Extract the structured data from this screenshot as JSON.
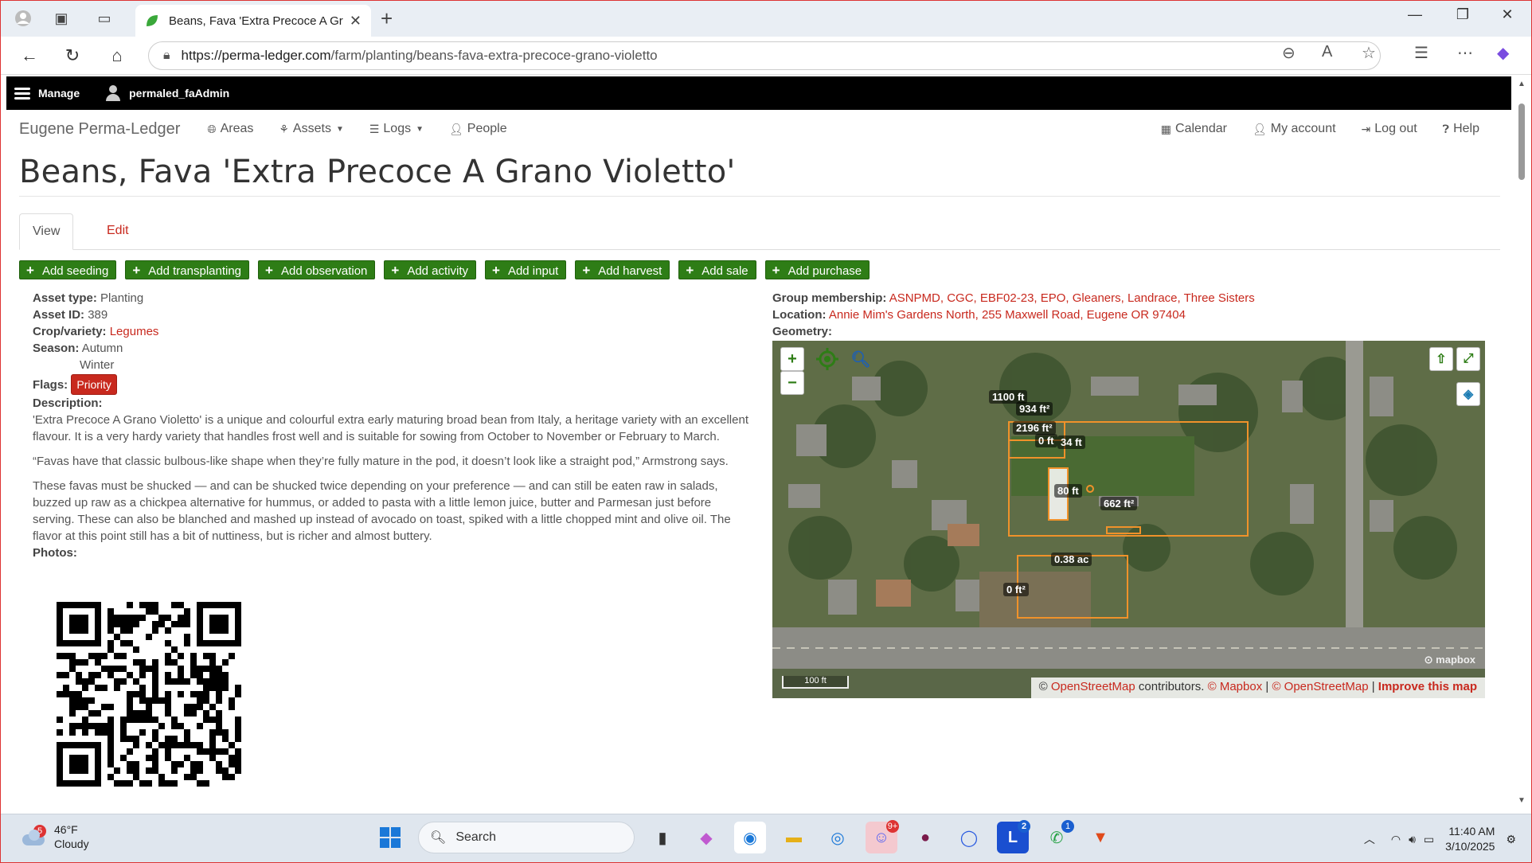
{
  "browser": {
    "tab_title": "Beans, Fava 'Extra Precoce A Gran",
    "url_host": "https://perma-ledger.com",
    "url_path": "/farm/planting/beans-fava-extra-precoce-grano-violetto"
  },
  "adminbar": {
    "manage_label": "Manage",
    "user_label": "permaled_faAdmin"
  },
  "sitenav": {
    "brand": "Eugene Perma-Ledger",
    "areas": "Areas",
    "assets": "Assets",
    "logs": "Logs",
    "people": "People",
    "calendar": "Calendar",
    "account": "My account",
    "logout": "Log out",
    "help": "Help"
  },
  "page": {
    "title": "Beans, Fava 'Extra Precoce A Grano Violetto'",
    "tab_view": "View",
    "tab_edit": "Edit"
  },
  "actions": [
    "Add seeding",
    "Add transplanting",
    "Add observation",
    "Add activity",
    "Add input",
    "Add harvest",
    "Add sale",
    "Add purchase"
  ],
  "details": {
    "asset_type_label": "Asset type:",
    "asset_type": "Planting",
    "asset_id_label": "Asset ID:",
    "asset_id": "389",
    "crop_label": "Crop/variety:",
    "crop": "Legumes",
    "season_label": "Season:",
    "season_1": "Autumn",
    "season_2": "Winter",
    "flags_label": "Flags:",
    "flag": "Priority",
    "description_label": "Description:",
    "desc_p1": "'Extra Precoce A Grano Violetto' is a unique and colourful extra early maturing broad bean from Italy, a heritage variety with an excellent flavour. It is a very hardy variety that handles frost well and is suitable for sowing from October to November or February to March.",
    "desc_p2": "“Favas have that classic bulbous-like shape when they’re fully mature in the pod, it doesn’t look like a straight pod,” Armstrong says.",
    "desc_p3": "These favas must be shucked — and can be shucked twice depending on your preference — and can still be eaten raw in salads, buzzed up raw as a chickpea alternative for hummus, or added to pasta with a little lemon juice, butter and Parmesan just before serving. These can also be blanched and mashed up instead of avocado on toast, spiked with a little chopped mint and olive oil. The flavor at this point still has a bit of nuttiness, but is richer and almost buttery.",
    "photos_label": "Photos:"
  },
  "right": {
    "group_label": "Group membership:",
    "groups": "ASNPMD, CGC, EBF02-23, EPO, Gleaners, Landrace, Three Sisters",
    "location_label": "Location:",
    "location": "Annie Mim's Gardens North, 255 Maxwell Road, Eugene OR 97404",
    "geometry_label": "Geometry:"
  },
  "map": {
    "labels": [
      "1100 ft",
      "934 ft²",
      "2196 ft²",
      "0 ft",
      "34 ft",
      "80 ft",
      "662 ft²",
      "0.38 ac",
      "0 ft²"
    ],
    "scale": "100 ft",
    "mapbox": "mapbox",
    "attrib_prefix": "©",
    "attrib_osm": "OpenStreetMap",
    "attrib_contrib": "contributors.",
    "attrib_mapbox": "© Mapbox",
    "attrib_osm2": "© OpenStreetMap",
    "attrib_improve": "Improve this map"
  },
  "taskbar": {
    "weather_temp": "46°F",
    "weather_cond": "Cloudy",
    "weather_badge": "5",
    "search": "Search",
    "time": "11:40 AM",
    "date": "3/10/2025",
    "badge_discord": "9+",
    "badge_l": "2",
    "badge_whatsapp": "1"
  },
  "colors": {
    "accent_red": "#c8291e",
    "action_green": "#2e7d16",
    "map_outline": "#f0922a"
  }
}
